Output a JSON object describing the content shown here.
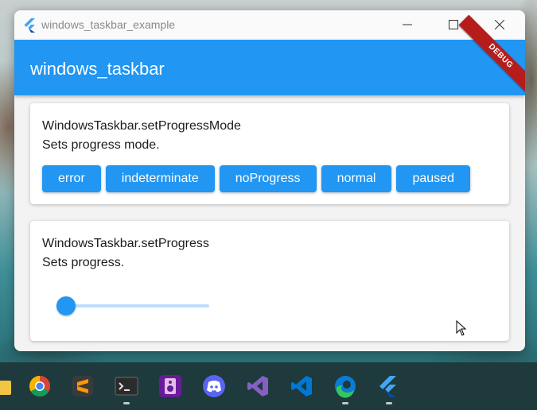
{
  "window": {
    "title": "windows_taskbar_example"
  },
  "appbar": {
    "title": "windows_taskbar",
    "debug_banner": "DEBUG"
  },
  "progress_mode_card": {
    "title": "WindowsTaskbar.setProgressMode",
    "subtitle": "Sets progress mode.",
    "buttons": [
      "error",
      "indeterminate",
      "noProgress",
      "normal",
      "paused"
    ]
  },
  "progress_card": {
    "title": "WindowsTaskbar.setProgress",
    "subtitle": "Sets progress.",
    "slider_value": 0
  },
  "colors": {
    "primary": "#2196f3",
    "slider_inactive": "#bbdefb",
    "debug_banner": "#b71c1c"
  },
  "taskbar": {
    "icons": [
      "file-explorer-icon",
      "chrome-icon",
      "sublime-text-icon",
      "terminal-icon",
      "winamp-icon",
      "discord-icon",
      "visual-studio-icon",
      "vscode-icon",
      "edge-icon",
      "flutter-icon"
    ]
  }
}
